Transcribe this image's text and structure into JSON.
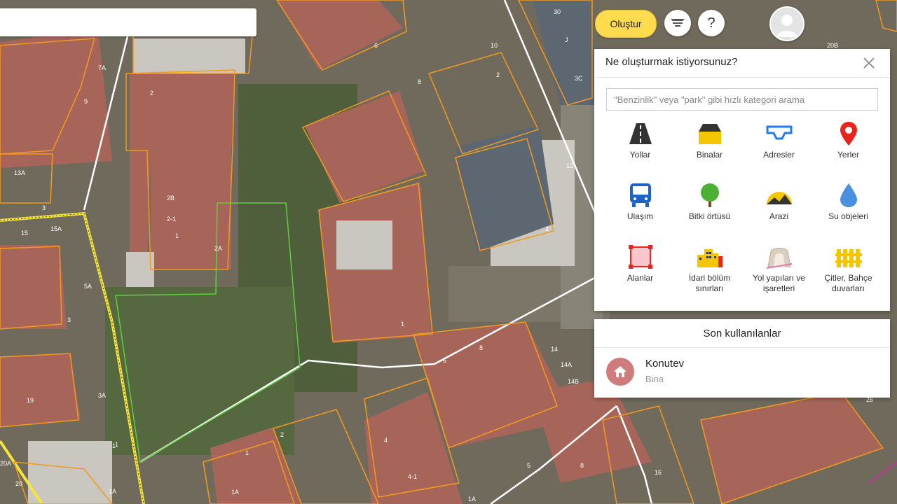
{
  "map": {
    "labels": [
      "30",
      "6",
      "10",
      "8",
      "3C",
      "20B",
      "7A",
      "2",
      "9",
      "13A",
      "2B",
      "2-1",
      "2A",
      "15",
      "15A",
      "5A",
      "3",
      "19",
      "3A",
      "1",
      "20A",
      "20",
      "1A",
      "2",
      "4",
      "4-1",
      "5",
      "6",
      "8",
      "14",
      "14A",
      "14B",
      "12",
      "3",
      "1",
      "1",
      "1A",
      "16",
      "26",
      "1",
      "2",
      "3",
      "J",
      "8",
      "1",
      "1A"
    ]
  },
  "topbar": {
    "create_label": "Oluştur",
    "help_label": "?"
  },
  "panel": {
    "title": "Ne oluşturmak istiyorsunuz?",
    "search_placeholder": "\"Benzinlik\" veya \"park\" gibi hızlı kategori arama",
    "categories": [
      {
        "label": "Yollar",
        "icon": "road-icon"
      },
      {
        "label": "Binalar",
        "icon": "building-icon"
      },
      {
        "label": "Adresler",
        "icon": "address-icon"
      },
      {
        "label": "Yerler",
        "icon": "place-pin-icon"
      },
      {
        "label": "Ulaşım",
        "icon": "bus-icon"
      },
      {
        "label": "Bitki örtüsü",
        "icon": "tree-icon"
      },
      {
        "label": "Arazi",
        "icon": "terrain-icon"
      },
      {
        "label": "Su objeleri",
        "icon": "water-drop-icon"
      },
      {
        "label": "Alanlar",
        "icon": "area-icon"
      },
      {
        "label": "İdari bölüm sınırları",
        "icon": "admin-boundary-icon"
      },
      {
        "label": "Yol yapıları ve işaretleri",
        "icon": "tunnel-icon"
      },
      {
        "label": "Çitler, Bahçe duvarları",
        "icon": "fence-icon"
      }
    ]
  },
  "recent": {
    "title": "Son kullanılanlar",
    "items": [
      {
        "title": "Konutev",
        "subtitle": "Bina",
        "icon": "house-icon"
      }
    ]
  },
  "colors": {
    "accent_yellow": "#ffdb4d",
    "parcel_orange": "#f39a1e",
    "green_area": "#5fcf3f",
    "pin_red": "#e8241d",
    "bus_blue": "#1e64c8"
  }
}
